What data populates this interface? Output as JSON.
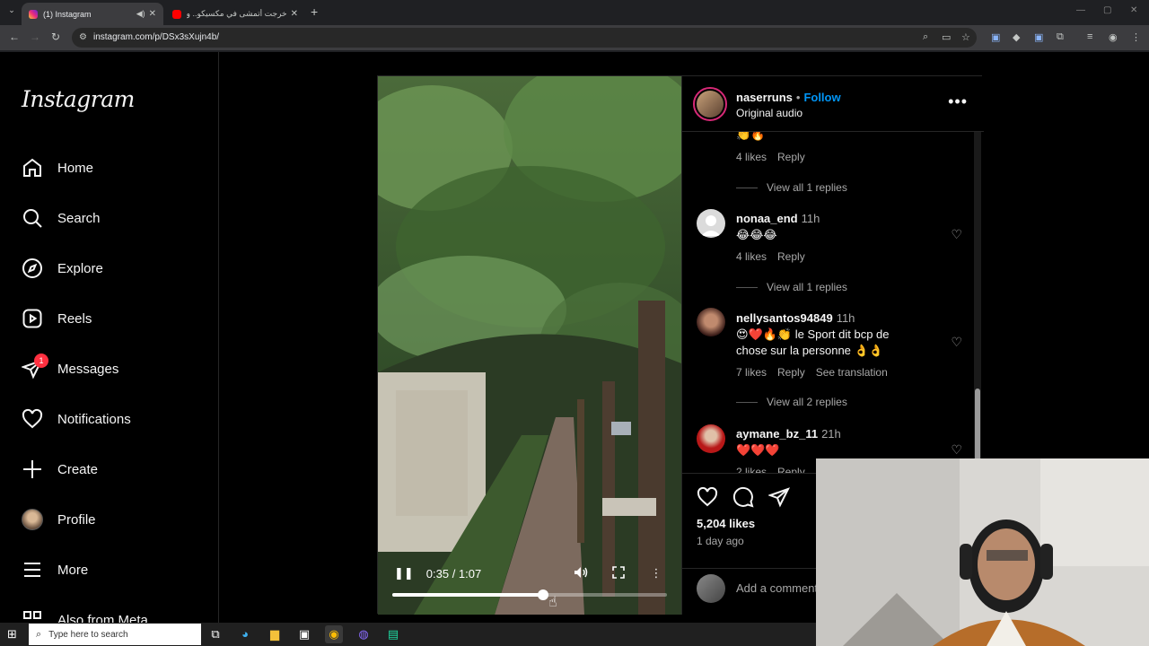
{
  "browser": {
    "tabs": [
      {
        "title": "(1) Instagram",
        "active": true
      },
      {
        "title": "خرجت أتمشى في مكسيكو.. ولعر",
        "active": false
      }
    ],
    "url": "instagram.com/p/DSx3sXujn4b/",
    "new_tab": "+",
    "min": "—",
    "max": "▢",
    "close": "✕"
  },
  "sidebar": {
    "logo": "Instagram",
    "items": [
      {
        "label": "Home",
        "icon": "home-icon"
      },
      {
        "label": "Search",
        "icon": "search-icon"
      },
      {
        "label": "Explore",
        "icon": "compass-icon"
      },
      {
        "label": "Reels",
        "icon": "reels-icon"
      },
      {
        "label": "Messages",
        "icon": "messenger-icon",
        "badge": "1"
      },
      {
        "label": "Notifications",
        "icon": "heart-icon"
      },
      {
        "label": "Create",
        "icon": "plus-icon"
      },
      {
        "label": "Profile",
        "icon": "avatar"
      },
      {
        "label": "More",
        "icon": "menu-icon"
      },
      {
        "label": "Also from Meta",
        "icon": "meta-icon"
      }
    ]
  },
  "video": {
    "time": "0:35 / 1:07",
    "progress": 0.55
  },
  "post": {
    "username": "naserruns",
    "separator": "•",
    "follow": "Follow",
    "audio": "Original audio",
    "likes": "5,204 likes",
    "date": "1 day ago",
    "add_comment_placeholder": "Add a comment…"
  },
  "comments": [
    {
      "text": "👏🔥",
      "likes": "4 likes",
      "reply": "Reply",
      "view": "View all 1 replies"
    },
    {
      "user": "nonaa_end",
      "time": "11h",
      "text": "😂😂😂",
      "likes": "4 likes",
      "reply": "Reply",
      "view": "View all 1 replies"
    },
    {
      "user": "nellysantos94849",
      "time": "11h",
      "text": "😍❤️🔥👏 le Sport dit bcp de",
      "text2": "chose sur la personne 👌👌",
      "likes": "7 likes",
      "reply": "Reply",
      "translate": "See translation",
      "view": "View all 2 replies"
    },
    {
      "user": "aymane_bz_11",
      "time": "21h",
      "text": "❤️❤️❤️",
      "likes": "2 likes",
      "reply": "Reply"
    }
  ],
  "taskbar": {
    "search_placeholder": "Type here to search"
  },
  "colors": {
    "accent": "#0095f6",
    "badge": "#ff3040",
    "background": "#000000"
  }
}
